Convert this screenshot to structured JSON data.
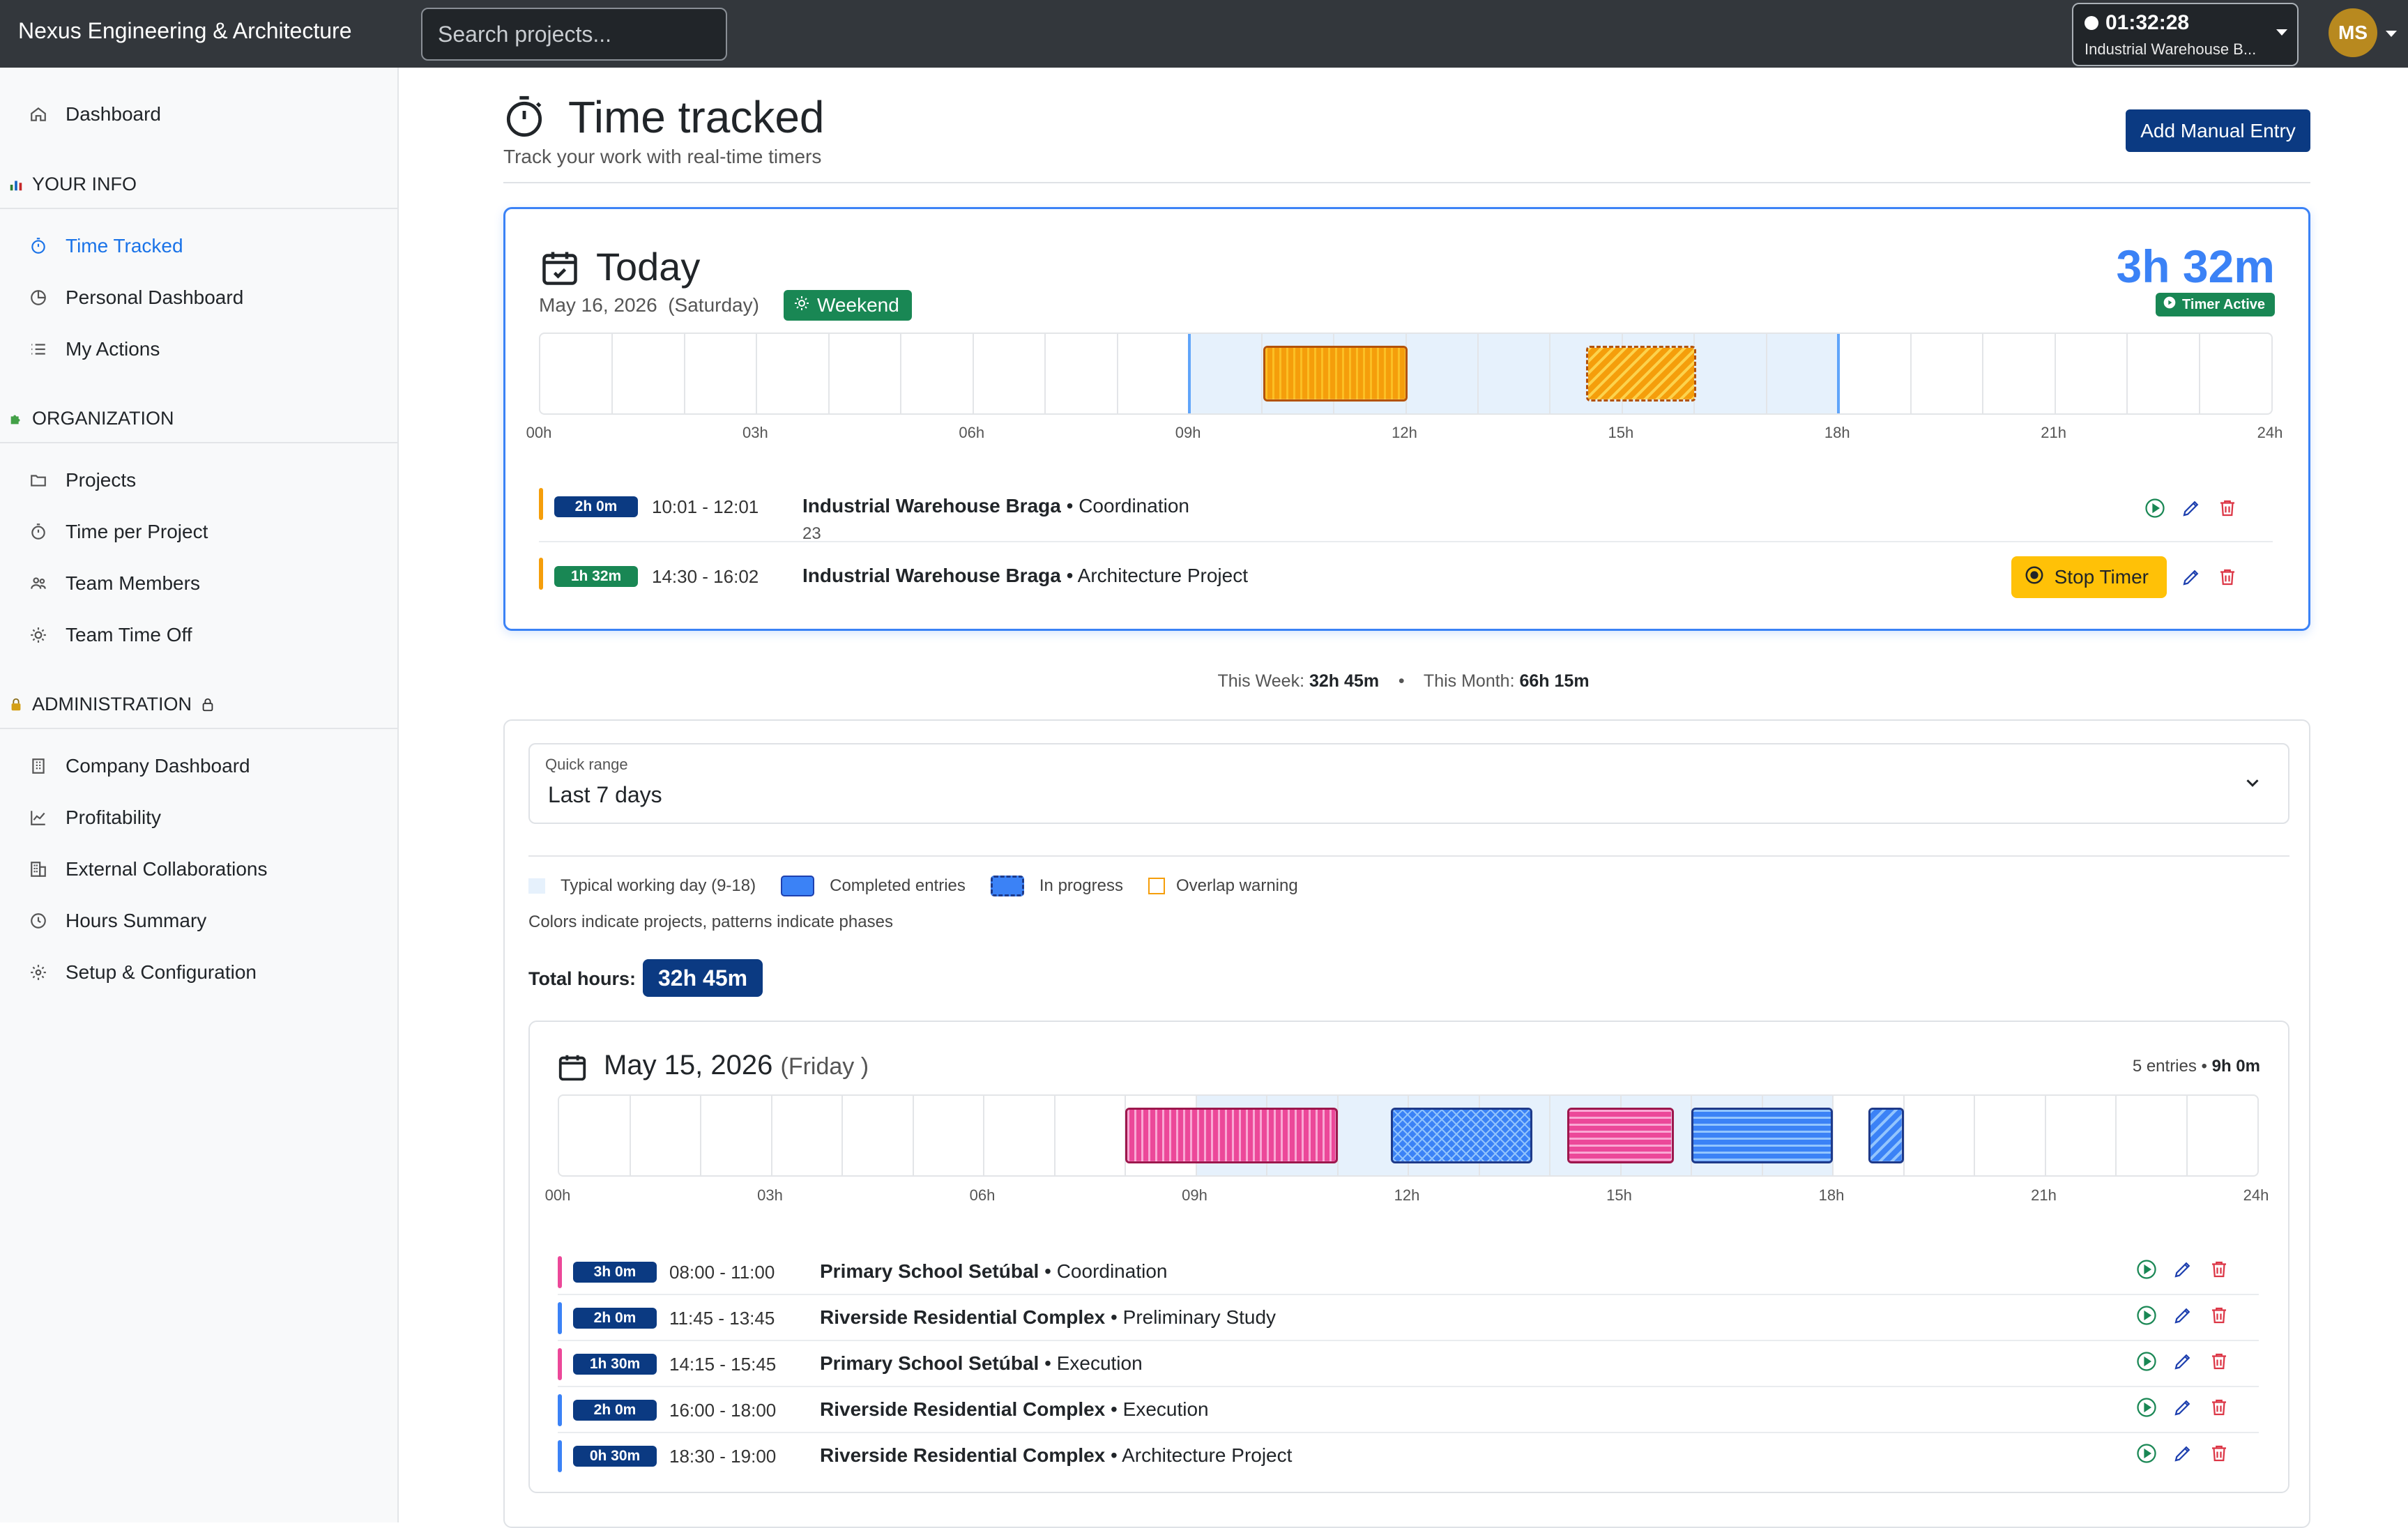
{
  "app": {
    "brand": "Nexus Engineering & Architecture",
    "search_placeholder": "Search projects...",
    "timer": {
      "elapsed": "01:32:28",
      "project": "Industrial Warehouse B..."
    },
    "user": {
      "initials": "MS"
    }
  },
  "sidebar": {
    "dashboard": "Dashboard",
    "sections": [
      {
        "title": "YOUR INFO",
        "items": [
          "Time Tracked",
          "Personal Dashboard",
          "My Actions"
        ]
      },
      {
        "title": "ORGANIZATION",
        "items": [
          "Projects",
          "Time per Project",
          "Team Members",
          "Team Time Off"
        ]
      },
      {
        "title": "ADMINISTRATION",
        "items": [
          "Company Dashboard",
          "Profitability",
          "External Collaborations",
          "Hours Summary",
          "Setup & Configuration"
        ]
      }
    ],
    "active_item": "Time Tracked"
  },
  "header": {
    "title": "Time tracked",
    "subtitle": "Track your work with real-time timers",
    "add_button": "Add Manual Entry"
  },
  "today": {
    "title": "Today",
    "date": "May 16, 2026",
    "weekday": "(Saturday)",
    "badge": "Weekend",
    "total": "3h 32m",
    "timer_status": "Timer Active",
    "ticks": [
      "00h",
      "03h",
      "06h",
      "09h",
      "12h",
      "15h",
      "18h",
      "21h",
      "24h"
    ],
    "now_hour": 18,
    "blocks": [
      {
        "start": 10.02,
        "end": 12.02,
        "color": "#f59e0b",
        "pattern": "vertical",
        "in_progress": false
      },
      {
        "start": 14.5,
        "end": 16.03,
        "color": "#f59e0b",
        "pattern": "diagonal",
        "in_progress": true
      }
    ],
    "entries": [
      {
        "duration": "2h 0m",
        "range": "10:01 - 12:01",
        "project": "Industrial Warehouse Braga",
        "phase": "Coordination",
        "note": "23",
        "color": "#f59e0b",
        "badge_color": "#0b3a82"
      },
      {
        "duration": "1h 32m",
        "range": "14:30 - 16:02",
        "project": "Industrial Warehouse Braga",
        "phase": "Architecture Project",
        "note": "",
        "color": "#f59e0b",
        "badge_color": "#198754",
        "stop_label": "Stop Timer"
      }
    ]
  },
  "summary": {
    "week_label": "This Week:",
    "week_value": "32h 45m",
    "month_label": "This Month:",
    "month_value": "66h 15m"
  },
  "range": {
    "label": "Quick range",
    "value": "Last 7 days",
    "legend": [
      "Typical working day (9-18)",
      "Completed entries",
      "In progress",
      "Overlap warning"
    ],
    "legend_note": "Colors indicate projects, patterns indicate phases",
    "total_label": "Total hours:",
    "total_value": "32h 45m"
  },
  "day": {
    "date": "May 15, 2026",
    "weekday": "(Friday )",
    "entries_count": "5 entries",
    "total": "9h 0m",
    "ticks": [
      "00h",
      "03h",
      "06h",
      "09h",
      "12h",
      "15h",
      "18h",
      "21h",
      "24h"
    ],
    "blocks": [
      {
        "start": 8,
        "end": 11,
        "color": "#ec4899",
        "pattern": "vertical"
      },
      {
        "start": 11.75,
        "end": 13.75,
        "color": "#3b82f6",
        "pattern": "cross"
      },
      {
        "start": 14.25,
        "end": 15.75,
        "color": "#ec4899",
        "pattern": "horizontal"
      },
      {
        "start": 16,
        "end": 18,
        "color": "#3b82f6",
        "pattern": "horizontal"
      },
      {
        "start": 18.5,
        "end": 19,
        "color": "#3b82f6",
        "pattern": "diagonal"
      }
    ],
    "entries": [
      {
        "duration": "3h 0m",
        "range": "08:00 - 11:00",
        "project": "Primary School Setúbal",
        "phase": "Coordination",
        "color": "#ec4899"
      },
      {
        "duration": "2h 0m",
        "range": "11:45 - 13:45",
        "project": "Riverside Residential Complex",
        "phase": "Preliminary Study",
        "color": "#3b82f6"
      },
      {
        "duration": "1h 30m",
        "range": "14:15 - 15:45",
        "project": "Primary School Setúbal",
        "phase": "Execution",
        "color": "#ec4899"
      },
      {
        "duration": "2h 0m",
        "range": "16:00 - 18:00",
        "project": "Riverside Residential Complex",
        "phase": "Execution",
        "color": "#3b82f6"
      },
      {
        "duration": "0h 30m",
        "range": "18:30 - 19:00",
        "project": "Riverside Residential Complex",
        "phase": "Architecture Project",
        "color": "#3b82f6"
      }
    ]
  },
  "colors": {
    "accent": "#3b82f6",
    "brand_dark": "#0b3a82",
    "success": "#198754",
    "warning": "#ffc107"
  }
}
